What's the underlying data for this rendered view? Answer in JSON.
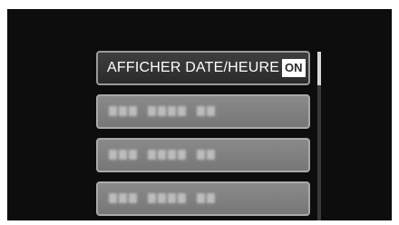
{
  "menu": {
    "selected_item": {
      "label": "AFFICHER DATE/HEURE",
      "badge": "ON"
    },
    "hidden_items": [
      {
        "word_lengths": [
          3,
          4,
          2
        ]
      },
      {
        "word_lengths": [
          3,
          4,
          2
        ]
      },
      {
        "word_lengths": [
          3,
          4,
          2
        ]
      }
    ]
  },
  "scrollbar": {
    "thumb_position": 0,
    "visible_fraction": 0.2
  },
  "colors": {
    "screen_background": "#0d0d0d",
    "selected_item_background": "#2b2b2b",
    "dimmed_item_background": "#808080",
    "text": "#ffffff"
  }
}
